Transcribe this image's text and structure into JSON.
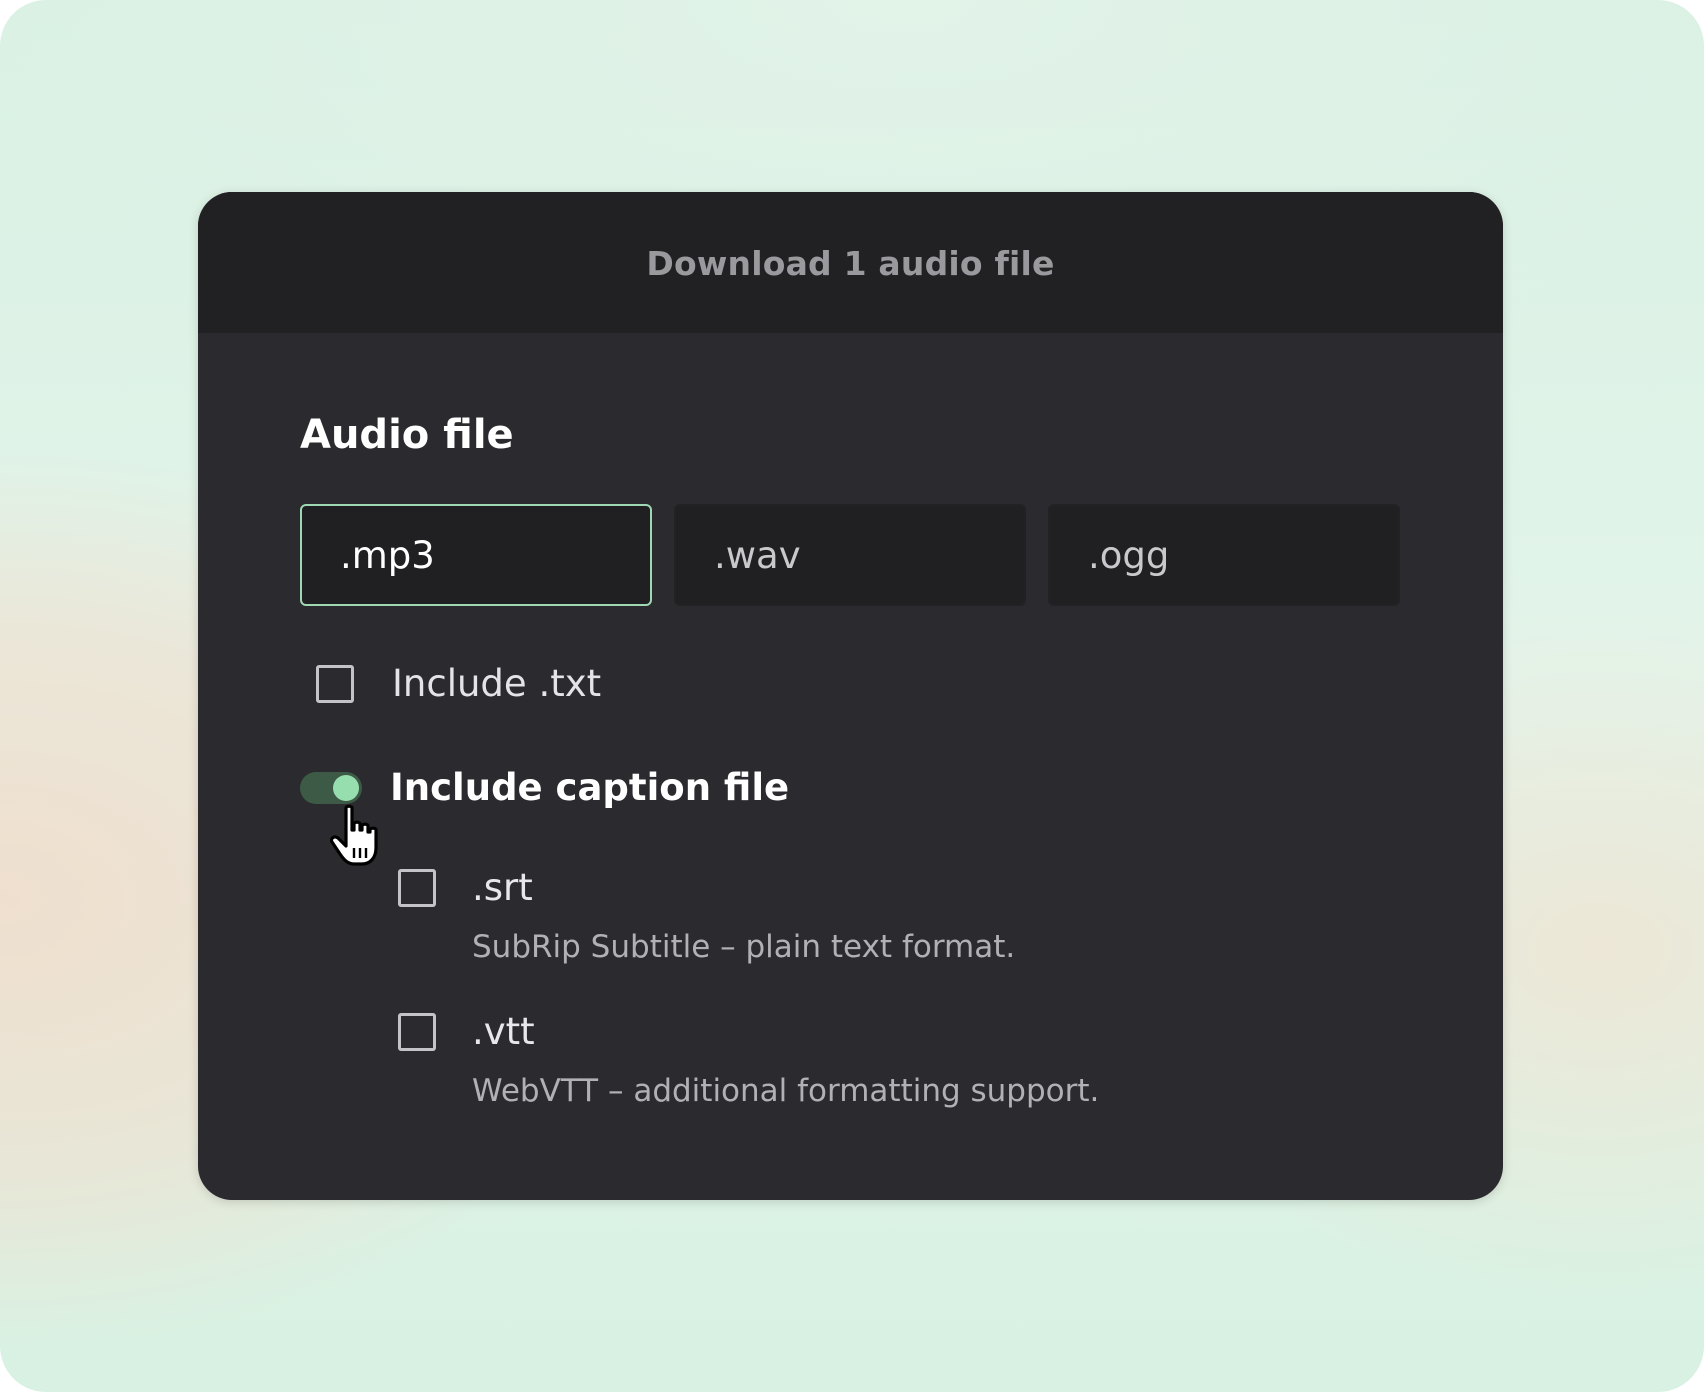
{
  "dialog": {
    "title": "Download 1 audio file"
  },
  "audio": {
    "section_title": "Audio file",
    "formats": [
      {
        "label": ".mp3",
        "selected": true
      },
      {
        "label": ".wav",
        "selected": false
      },
      {
        "label": ".ogg",
        "selected": false
      }
    ]
  },
  "include_txt": {
    "label": "Include .txt",
    "checked": false
  },
  "captions": {
    "label": "Include caption file",
    "enabled": true,
    "options": [
      {
        "label": ".srt",
        "description": "SubRip Subtitle – plain text format.",
        "checked": false
      },
      {
        "label": ".vtt",
        "description": "WebVTT – additional formatting support.",
        "checked": false
      }
    ]
  },
  "colors": {
    "accent": "#97deaf",
    "dialog_bg": "#2b2a2e",
    "header_bg": "#212023"
  },
  "icons": {
    "cursor": "hand-pointer-icon"
  }
}
